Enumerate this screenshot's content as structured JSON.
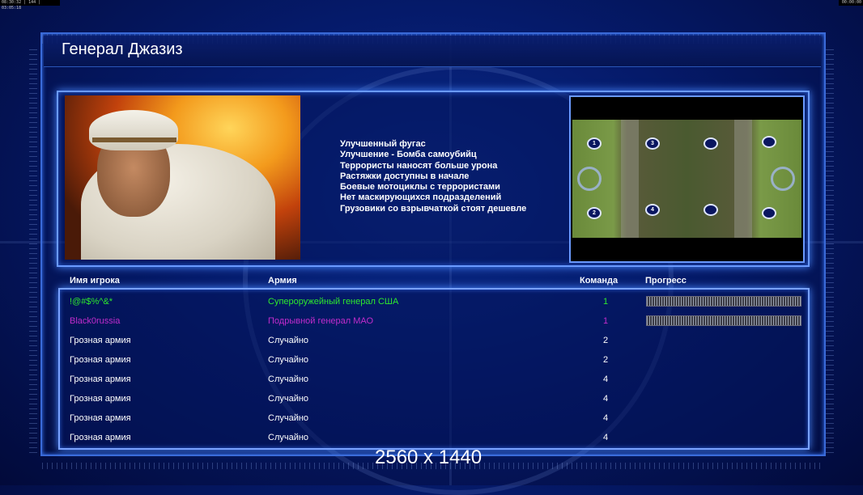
{
  "hud": {
    "time_left": "08:30:32 | 144 | 03:05:18",
    "time_right": "00:00:00"
  },
  "title": "Генерал Джазиз",
  "upgrades": [
    "Улучшенный фугас",
    "Улучшение - Бомба самоубийц",
    "Террористы наносят больше урона",
    "Растяжки доступны в начале",
    "Боевые мотоциклы с террористами",
    "Нет маскирующихся подразделений",
    "Грузовики со взрывчаткой стоят дешевле"
  ],
  "minimap": {
    "positions": [
      "1",
      "3",
      "2",
      "4"
    ]
  },
  "table": {
    "headers": {
      "player": "Имя игрока",
      "army": "Армия",
      "team": "Команда",
      "progress": "Прогресс"
    },
    "rows": [
      {
        "player": "!@#$%^&*",
        "army": "Супероружейный генерал США",
        "team": "1",
        "color": "#2ee82e",
        "progress": 1.0
      },
      {
        "player": "Black0russia",
        "army": "Подрывной генерал МАО",
        "team": "1",
        "color": "#c22ccc",
        "progress": 1.0
      },
      {
        "player": "Грозная армия",
        "army": "Случайно",
        "team": "2",
        "color": "#ffffff"
      },
      {
        "player": "Грозная армия",
        "army": "Случайно",
        "team": "2",
        "color": "#ffffff"
      },
      {
        "player": "Грозная армия",
        "army": "Случайно",
        "team": "4",
        "color": "#ffffff"
      },
      {
        "player": "Грозная армия",
        "army": "Случайно",
        "team": "4",
        "color": "#ffffff"
      },
      {
        "player": "Грозная армия",
        "army": "Случайно",
        "team": "4",
        "color": "#ffffff"
      },
      {
        "player": "Грозная армия",
        "army": "Случайно",
        "team": "4",
        "color": "#ffffff"
      }
    ]
  },
  "resolution_label": "2560 x 1440"
}
